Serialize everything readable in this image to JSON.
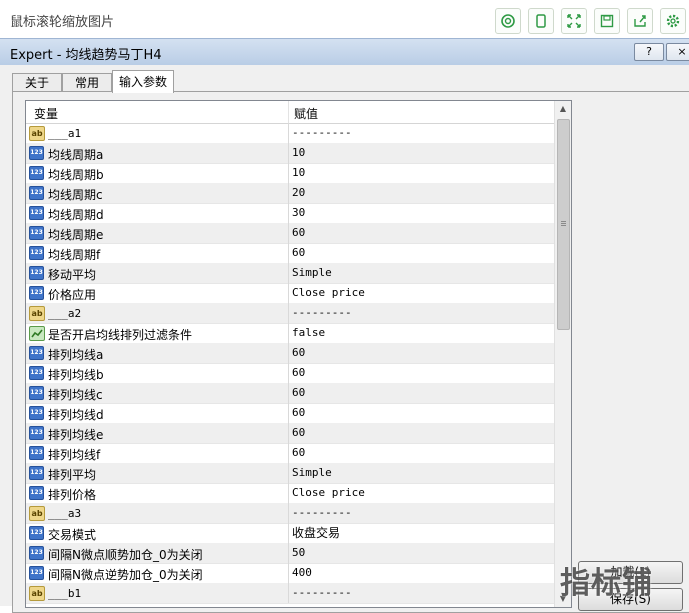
{
  "topbar": {
    "title": "鼠标滚轮缩放图片",
    "tools": [
      "scan-icon",
      "phone-icon",
      "fullscreen-icon",
      "save-icon",
      "share-icon",
      "settings-icon"
    ],
    "accent": "#2e9a44"
  },
  "titlebar": {
    "title": "Expert - 均线趋势马丁H4",
    "help_label": "?",
    "close_label": "×"
  },
  "tabs": [
    {
      "label": "关于"
    },
    {
      "label": "常用"
    },
    {
      "label": "输入参数"
    }
  ],
  "grid": {
    "col_variable": "变量",
    "col_value": "赋值",
    "rows": [
      {
        "type": "str",
        "name": "___a1",
        "value": "---------"
      },
      {
        "type": "num",
        "name": "均线周期a",
        "value": "10"
      },
      {
        "type": "num",
        "name": "均线周期b",
        "value": "10"
      },
      {
        "type": "num",
        "name": "均线周期c",
        "value": "20"
      },
      {
        "type": "num",
        "name": "均线周期d",
        "value": "30"
      },
      {
        "type": "num",
        "name": "均线周期e",
        "value": "60"
      },
      {
        "type": "num",
        "name": "均线周期f",
        "value": "60"
      },
      {
        "type": "num",
        "name": "移动平均",
        "value": "Simple"
      },
      {
        "type": "num",
        "name": "价格应用",
        "value": "Close price"
      },
      {
        "type": "str",
        "name": "___a2",
        "value": "---------"
      },
      {
        "type": "bool",
        "name": "是否开启均线排列过滤条件",
        "value": "false"
      },
      {
        "type": "num",
        "name": "排列均线a",
        "value": "60"
      },
      {
        "type": "num",
        "name": "排列均线b",
        "value": "60"
      },
      {
        "type": "num",
        "name": "排列均线c",
        "value": "60"
      },
      {
        "type": "num",
        "name": "排列均线d",
        "value": "60"
      },
      {
        "type": "num",
        "name": "排列均线e",
        "value": "60"
      },
      {
        "type": "num",
        "name": "排列均线f",
        "value": "60"
      },
      {
        "type": "num",
        "name": "排列平均",
        "value": "Simple"
      },
      {
        "type": "num",
        "name": "排列价格",
        "value": "Close price"
      },
      {
        "type": "str",
        "name": "___a3",
        "value": "---------"
      },
      {
        "type": "num",
        "name": "交易模式",
        "value": "收盘交易"
      },
      {
        "type": "num",
        "name": "间隔N微点顺势加仓_0为关闭",
        "value": "50"
      },
      {
        "type": "num",
        "name": "间隔N微点逆势加仓_0为关闭",
        "value": "400"
      },
      {
        "type": "str",
        "name": "___b1",
        "value": "---------"
      }
    ]
  },
  "buttons": {
    "load": "加载(L)",
    "save": "保存(S)"
  },
  "watermark": "指标铺"
}
